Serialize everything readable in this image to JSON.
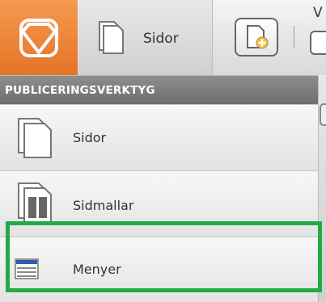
{
  "toolbar": {
    "logo_icon": "brand-logo-icon",
    "tab_sidor_label": "Sidor",
    "tab_sidor_icon": "pages-icon",
    "add_page_icon": "add-page-icon",
    "partial_label": "V"
  },
  "menu": {
    "header": "PUBLICERINGSVERKTYG",
    "items": [
      {
        "label": "Sidor",
        "icon": "pages-icon"
      },
      {
        "label": "Sidmallar",
        "icon": "page-templates-icon"
      },
      {
        "label": "Menyer",
        "icon": "menu-list-icon",
        "highlighted": true
      }
    ]
  },
  "colors": {
    "brand_orange": "#ee8437",
    "highlight_green": "#22aa44",
    "menu_icon_blue": "#2f5da8"
  }
}
